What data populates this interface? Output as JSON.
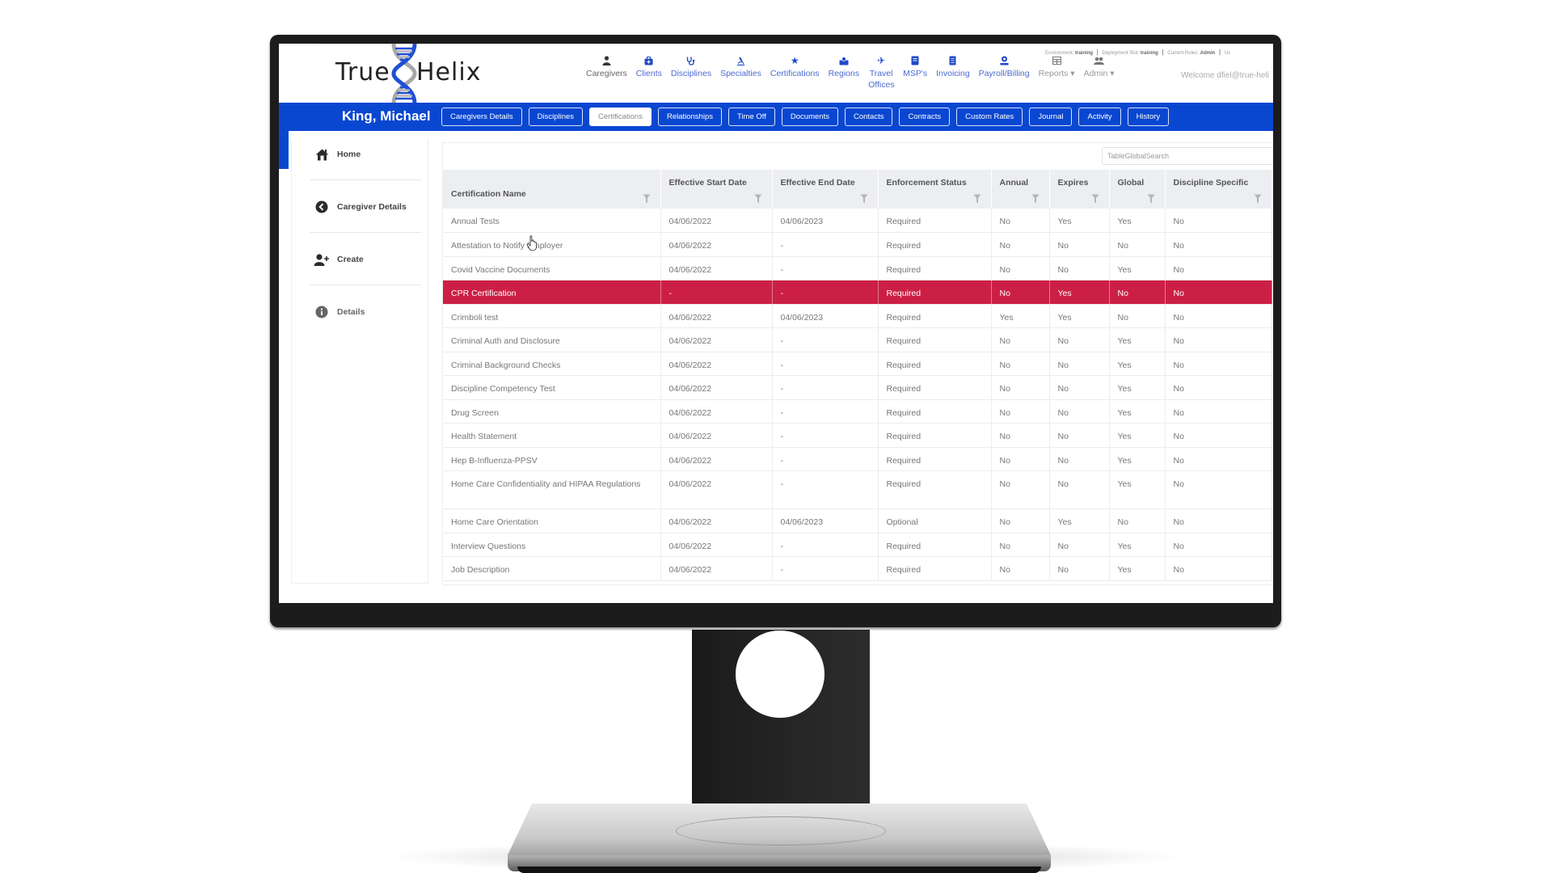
{
  "app": {
    "logo_left": "True",
    "logo_right": "Helix",
    "brand_color": "#0a47d1",
    "selected_row_color": "#cc1f45"
  },
  "nav": {
    "items": [
      {
        "label": "Caregivers",
        "icon": "caregiver-icon"
      },
      {
        "label": "Clients",
        "icon": "medkit-icon"
      },
      {
        "label": "Disciplines",
        "icon": "stethoscope-icon"
      },
      {
        "label": "Specialties",
        "icon": "microscope-icon"
      },
      {
        "label": "Certifications",
        "icon": "star-icon"
      },
      {
        "label": "Regions",
        "icon": "map-marker-icon"
      },
      {
        "label": "Travel Offices",
        "icon": "plane-icon"
      },
      {
        "label": "MSP's",
        "icon": "book-icon"
      },
      {
        "label": "Invoicing",
        "icon": "document-icon"
      },
      {
        "label": "Payroll/Billing",
        "icon": "payroll-icon"
      },
      {
        "label": "Reports",
        "icon": "table-icon",
        "dropdown": true
      },
      {
        "label": "Admin",
        "icon": "users-cog-icon",
        "dropdown": true
      }
    ],
    "environment_label": "Environment:",
    "environment_value": "training",
    "deployment_label": "Deployment Slot:",
    "deployment_value": "training",
    "roles_label": "Current Roles:",
    "roles_value": "Admin",
    "env_trailing": "Us",
    "welcome": "Welcome dfiel@true-heli"
  },
  "subnav": {
    "caregiver_name": "King, Michael",
    "tabs": [
      {
        "label": "Caregivers Details",
        "active": false
      },
      {
        "label": "Disciplines",
        "active": false
      },
      {
        "label": "Certifications",
        "active": true
      },
      {
        "label": "Relationships",
        "active": false
      },
      {
        "label": "Time Off",
        "active": false
      },
      {
        "label": "Documents",
        "active": false
      },
      {
        "label": "Contacts",
        "active": false
      },
      {
        "label": "Contracts",
        "active": false
      },
      {
        "label": "Custom Rates",
        "active": false
      },
      {
        "label": "Journal",
        "active": false
      },
      {
        "label": "Activity",
        "active": false
      },
      {
        "label": "History",
        "active": false
      }
    ]
  },
  "sidebar": {
    "items": [
      {
        "label": "Home",
        "icon": "home-icon"
      },
      {
        "label": "Caregiver Details",
        "icon": "chevron-left-circle-icon"
      },
      {
        "label": "Create",
        "icon": "user-plus-icon"
      },
      {
        "label": "Details",
        "icon": "info-circle-icon"
      }
    ]
  },
  "table": {
    "search_placeholder": "TableGlobalSearch",
    "columns": [
      "Certification Name",
      "Effective Start Date",
      "Effective End Date",
      "Enforcement Status",
      "Annual",
      "Expires",
      "Global",
      "Discipline Specific"
    ],
    "rows": [
      [
        "Annual Tests",
        "04/06/2022",
        "04/06/2023",
        "Required",
        "No",
        "Yes",
        "Yes",
        "No"
      ],
      [
        "Attestation to Notify Employer",
        "04/06/2022",
        "-",
        "Required",
        "No",
        "No",
        "No",
        "No"
      ],
      [
        "Covid Vaccine Documents",
        "04/06/2022",
        "-",
        "Required",
        "No",
        "No",
        "Yes",
        "No"
      ],
      [
        "CPR Certification",
        "-",
        "-",
        "Required",
        "No",
        "Yes",
        "No",
        "No"
      ],
      [
        "Crimboli test",
        "04/06/2022",
        "04/06/2023",
        "Required",
        "Yes",
        "Yes",
        "No",
        "No"
      ],
      [
        "Criminal Auth and Disclosure",
        "04/06/2022",
        "-",
        "Required",
        "No",
        "No",
        "Yes",
        "No"
      ],
      [
        "Criminal Background Checks",
        "04/06/2022",
        "-",
        "Required",
        "No",
        "No",
        "Yes",
        "No"
      ],
      [
        "Discipline Competency Test",
        "04/06/2022",
        "-",
        "Required",
        "No",
        "No",
        "Yes",
        "No"
      ],
      [
        "Drug Screen",
        "04/06/2022",
        "-",
        "Required",
        "No",
        "No",
        "Yes",
        "No"
      ],
      [
        "Health Statement",
        "04/06/2022",
        "-",
        "Required",
        "No",
        "No",
        "Yes",
        "No"
      ],
      [
        "Hep B-Influenza-PPSV",
        "04/06/2022",
        "-",
        "Required",
        "No",
        "No",
        "Yes",
        "No"
      ],
      [
        "Home Care Confidentiality and HIPAA Regulations",
        "04/06/2022",
        "-",
        "Required",
        "No",
        "No",
        "Yes",
        "No"
      ],
      [
        "Home Care Orientation",
        "04/06/2022",
        "04/06/2023",
        "Optional",
        "No",
        "Yes",
        "No",
        "No"
      ],
      [
        "Interview Questions",
        "04/06/2022",
        "-",
        "Required",
        "No",
        "No",
        "Yes",
        "No"
      ],
      [
        "Job Description",
        "04/06/2022",
        "-",
        "Required",
        "No",
        "No",
        "Yes",
        "No"
      ]
    ],
    "selected_row_index": 3
  }
}
